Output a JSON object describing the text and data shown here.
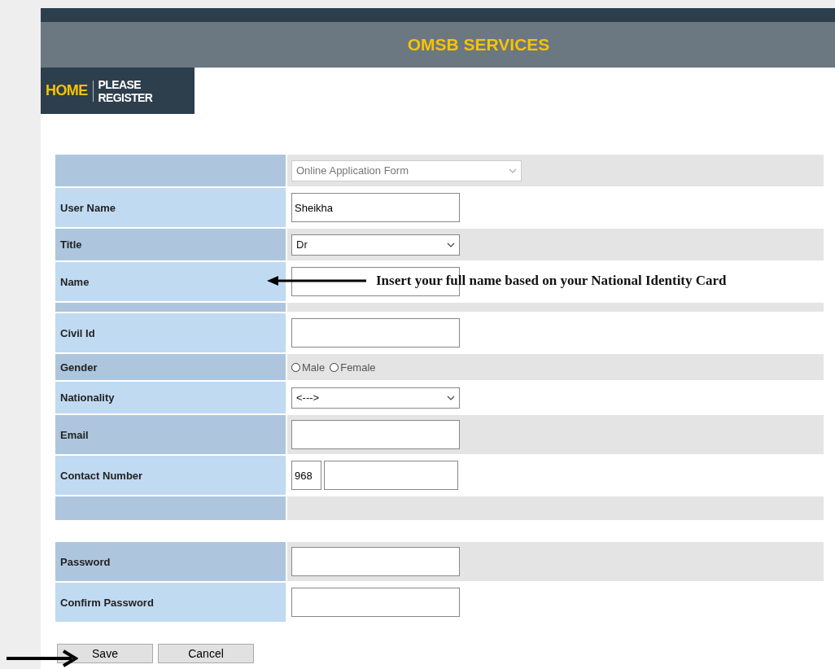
{
  "header": {
    "title": "OMSB SERVICES"
  },
  "nav": [
    {
      "label": "HOME",
      "selected": true
    },
    {
      "label": "PLEASE REGISTER",
      "selected": false
    }
  ],
  "form": {
    "groups": [
      [
        {
          "kind": "select",
          "value": "Online Application Form",
          "disabled": true
        },
        {
          "kind": "text",
          "label": "User Name",
          "value": "Sheikha"
        },
        {
          "kind": "select",
          "label": "Title",
          "value": "Dr",
          "disabled": false
        },
        {
          "kind": "text",
          "label": "Name",
          "annotation": "Insert your full name based on your National Identity Card"
        },
        {
          "kind": "spacer"
        },
        {
          "kind": "text",
          "label": "Civil Id"
        },
        {
          "kind": "radio",
          "label": "Gender",
          "options": [
            {
              "label": "Male",
              "selected": false
            },
            {
              "label": "Female",
              "selected": false
            }
          ]
        },
        {
          "kind": "select",
          "label": "Nationality",
          "value": "<--->",
          "disabled": false
        },
        {
          "kind": "text",
          "label": "Email"
        },
        {
          "kind": "phone",
          "label": "Contact Number",
          "code": "968"
        },
        {
          "kind": "blank"
        }
      ],
      [
        {
          "kind": "password",
          "label": "Password"
        },
        {
          "kind": "password",
          "label": "Confirm Password"
        }
      ]
    ]
  },
  "buttons": [
    {
      "label": "Save",
      "pointed": true
    },
    {
      "label": "Cancel",
      "pointed": false
    }
  ]
}
